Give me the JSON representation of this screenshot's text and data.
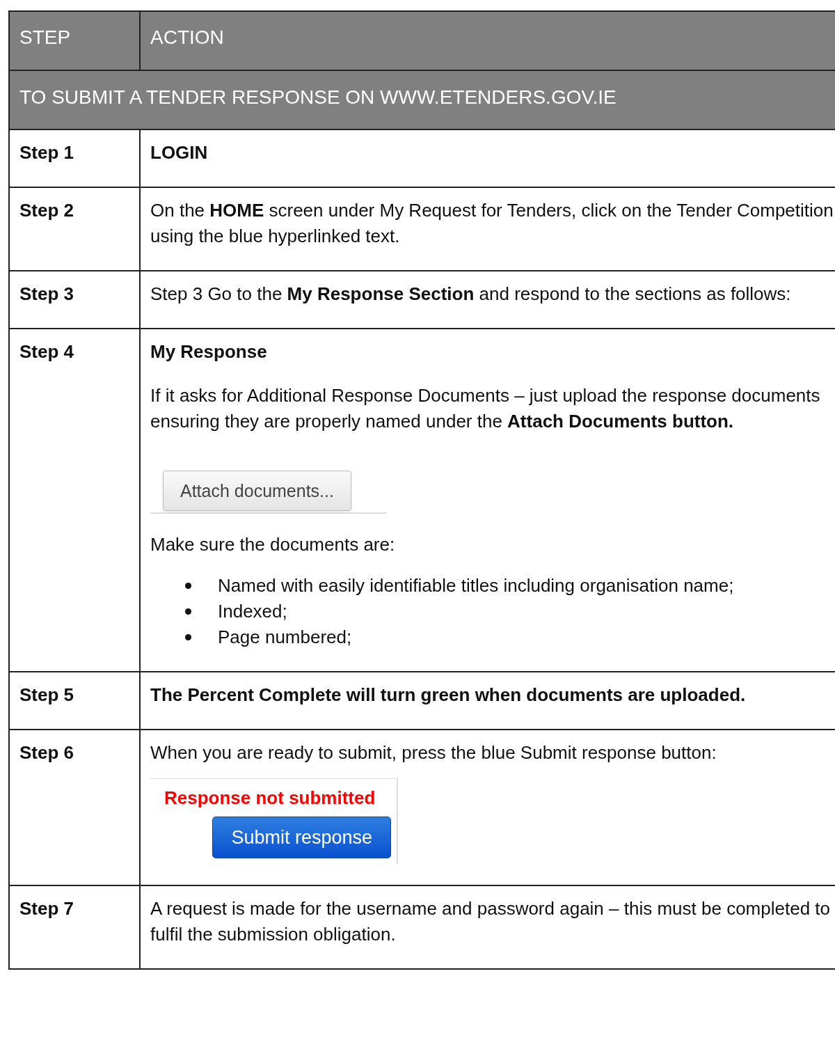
{
  "header": {
    "columns": [
      "STEP",
      "ACTION"
    ]
  },
  "section_title": "TO SUBMIT A TENDER RESPONSE ON WWW.ETENDERS.GOV.IE",
  "steps": [
    {
      "label": "Step 1",
      "content": [
        {
          "kind": "heading",
          "text": "LOGIN"
        }
      ]
    },
    {
      "label": "Step 2",
      "content": [
        {
          "kind": "paragraph",
          "text": "On the **HOME** screen under My Request for Tenders, click on the Tender Competition using the blue hyperlinked text."
        }
      ]
    },
    {
      "label": "Step 3",
      "content": [
        {
          "kind": "paragraph",
          "text": "Step 3  Go to the **My Response Section** and respond to the sections as follows:"
        }
      ]
    },
    {
      "label": "Step 4",
      "content": [
        {
          "kind": "heading",
          "text": "My Response"
        },
        {
          "kind": "paragraph",
          "text": "If it asks for Additional Response Documents – just upload the response documents ensuring they are properly named under the **Attach Documents button.**"
        },
        {
          "kind": "attach_button",
          "text": "Attach documents..."
        },
        {
          "kind": "paragraph",
          "text": "Make sure the documents are:"
        },
        {
          "kind": "bullets",
          "items": [
            "Named with easily identifiable titles including organisation name;",
            "Indexed;",
            "Page numbered;"
          ]
        }
      ]
    },
    {
      "label": "Step 5",
      "content": [
        {
          "kind": "heading",
          "text": "The Percent Complete will turn green when documents are uploaded."
        }
      ]
    },
    {
      "label": "Step 6",
      "content": [
        {
          "kind": "paragraph",
          "text": "When you are ready to submit, press the blue Submit response button:"
        },
        {
          "kind": "submit_panel",
          "status": "Response not submitted",
          "button": "Submit response"
        }
      ]
    },
    {
      "label": "Step 7",
      "content": [
        {
          "kind": "paragraph",
          "text": "A request is made for the username and password again – this must be completed to fulfil the submission obligation."
        }
      ]
    }
  ]
}
